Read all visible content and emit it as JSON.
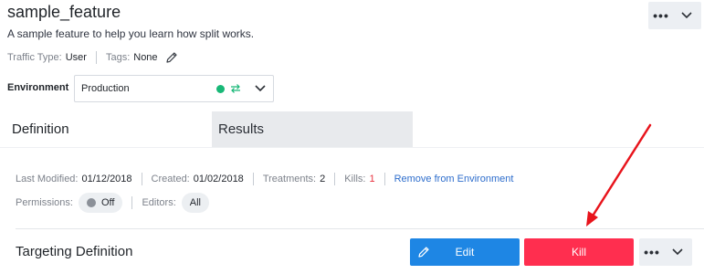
{
  "feature": {
    "name": "sample_feature",
    "description": "A sample feature to help you learn how split works."
  },
  "top_actions": {
    "more_label": "•••"
  },
  "meta": {
    "traffic_type_label": "Traffic Type:",
    "traffic_type_value": "User",
    "tags_label": "Tags:",
    "tags_value": "None"
  },
  "environment": {
    "label": "Environment",
    "selected": "Production",
    "status_color": "#18b877"
  },
  "tabs": [
    {
      "label": "Definition",
      "active": true
    },
    {
      "label": "Results",
      "active": false
    }
  ],
  "info": {
    "last_modified_label": "Last Modified:",
    "last_modified_value": "01/12/2018",
    "created_label": "Created:",
    "created_value": "01/02/2018",
    "treatments_label": "Treatments:",
    "treatments_value": "2",
    "kills_label": "Kills:",
    "kills_value": "1",
    "remove_link": "Remove from Environment"
  },
  "permissions": {
    "label": "Permissions:",
    "value": "Off",
    "editors_label": "Editors:",
    "editors_value": "All"
  },
  "targeting": {
    "title": "Targeting Definition",
    "edit_label": "Edit",
    "kill_label": "Kill",
    "more_label": "•••"
  },
  "colors": {
    "edit_button": "#1e86e4",
    "kill_button": "#ff2e4f",
    "link": "#2d6dcc",
    "arrow": "#e8141c"
  },
  "icons": [
    "pencil-icon",
    "status-dot-icon",
    "swap-arrows-icon",
    "chevron-down-icon",
    "more-dots-icon",
    "edit-pencil-icon"
  ]
}
